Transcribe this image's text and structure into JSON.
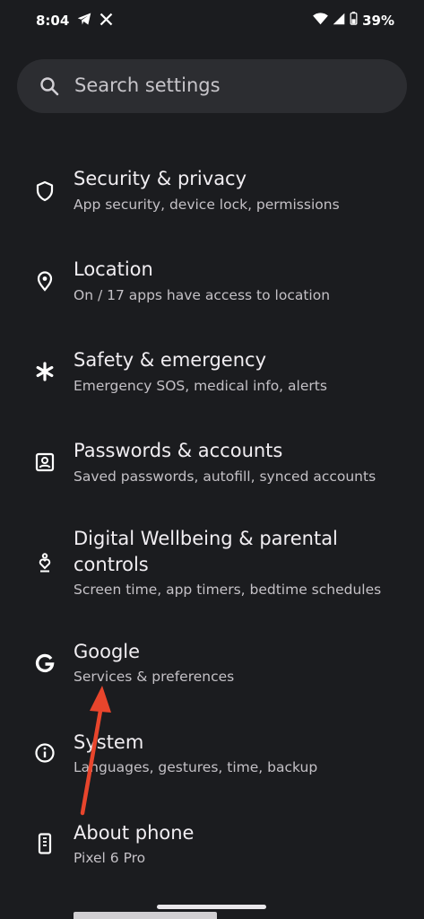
{
  "status_bar": {
    "time": "8:04",
    "battery": "39%",
    "icons": [
      "telegram-icon",
      "x-icon",
      "wifi-icon",
      "signal-icon",
      "battery-icon"
    ]
  },
  "search": {
    "placeholder": "Search settings"
  },
  "settings": {
    "items": [
      {
        "title": "Security & privacy",
        "subtitle": "App security, device lock, permissions",
        "icon": "shield-icon"
      },
      {
        "title": "Location",
        "subtitle": "On / 17 apps have access to location",
        "icon": "location-pin-icon"
      },
      {
        "title": "Safety & emergency",
        "subtitle": "Emergency SOS, medical info, alerts",
        "icon": "asterisk-icon"
      },
      {
        "title": "Passwords & accounts",
        "subtitle": "Saved passwords, autofill, synced accounts",
        "icon": "account-box-icon"
      },
      {
        "title": "Digital Wellbeing & parental",
        "title_line2": "controls",
        "subtitle": "Screen time, app timers, bedtime schedules",
        "icon": "wellbeing-icon"
      },
      {
        "title": "Google",
        "subtitle": "Services & preferences",
        "icon": "google-g-icon"
      },
      {
        "title": "System",
        "subtitle": "Languages, gestures, time, backup",
        "icon": "info-icon"
      },
      {
        "title": "About phone",
        "subtitle": "Pixel 6 Pro",
        "icon": "phone-icon"
      }
    ]
  },
  "colors": {
    "background": "#1b1c1f",
    "search_bg": "#2c2d31",
    "annotation_arrow": "#e8452c"
  }
}
